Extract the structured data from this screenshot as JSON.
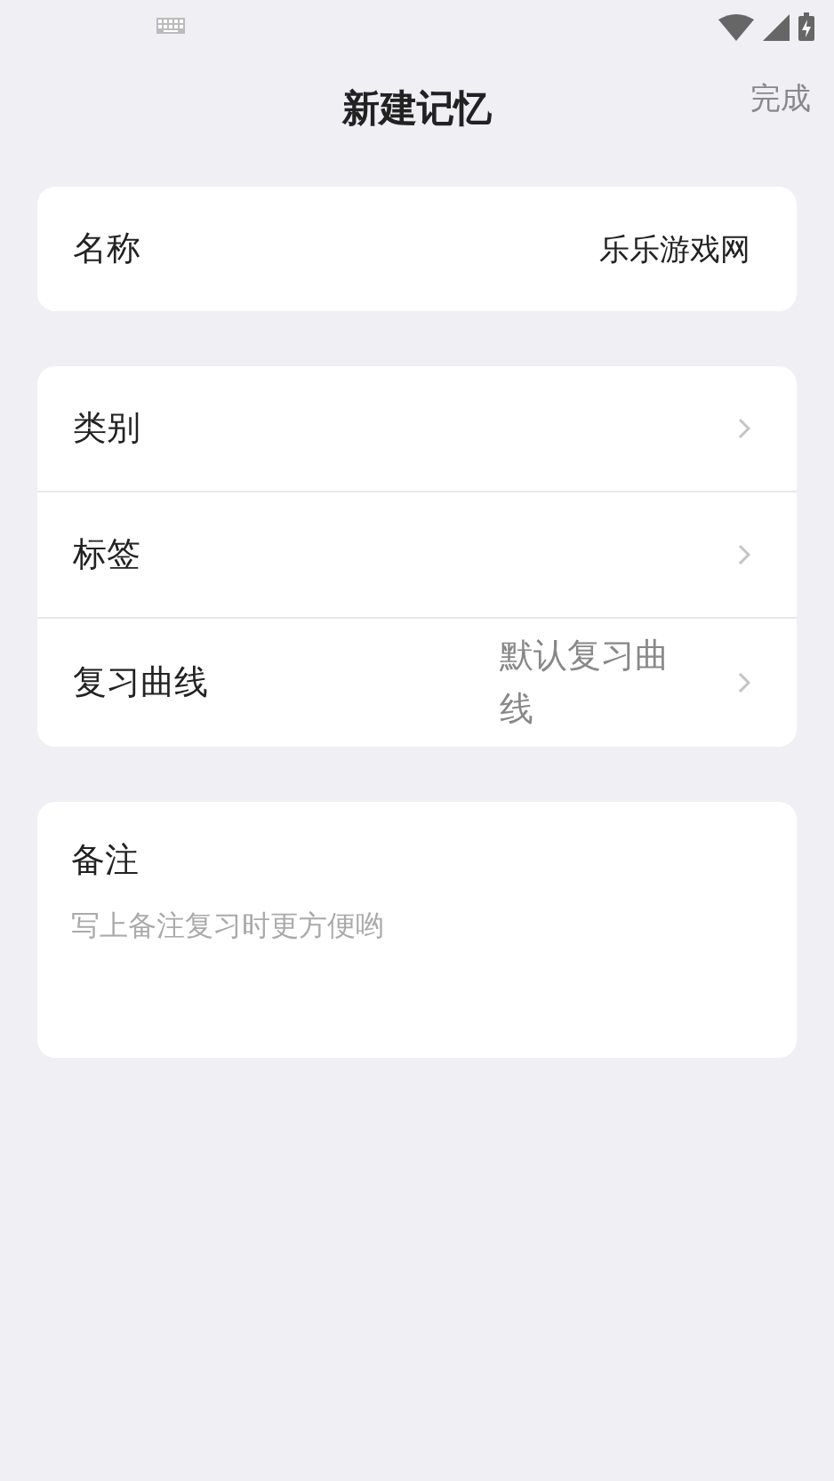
{
  "header": {
    "title": "新建记忆",
    "action": "完成"
  },
  "name_field": {
    "label": "名称",
    "value": "乐乐游戏网"
  },
  "rows": [
    {
      "label": "类别"
    },
    {
      "label": "标签"
    },
    {
      "label": "复习曲线",
      "value": "默认复习曲线"
    }
  ],
  "note": {
    "label": "备注",
    "placeholder": "写上备注复习时更方便哟"
  }
}
